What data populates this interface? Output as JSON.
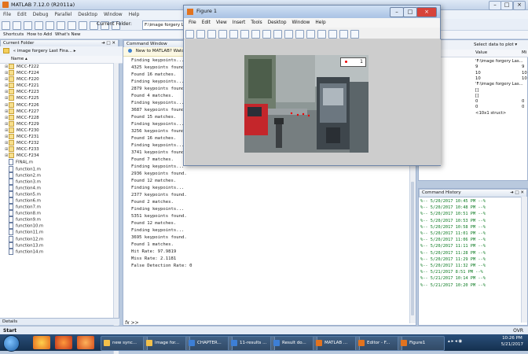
{
  "app": {
    "title": "MATLAB 7.12.0 (R2011a)",
    "menu": [
      "File",
      "Edit",
      "Debug",
      "Parallel",
      "Desktop",
      "Window",
      "Help"
    ],
    "current_folder_label": "Current Folder:",
    "current_folder_value": "F:\\image forgery Last Final\\...",
    "shortcuts": [
      "Shortcuts",
      "How to Add",
      "What's New"
    ]
  },
  "current_folder": {
    "header": "Current Folder",
    "path": "« image forgery Last Fina... ▸",
    "col_name": "Name ▴",
    "folders": [
      "MICC-F222",
      "MICC-F224",
      "MICC-F220",
      "MICC-F221",
      "MICC-F223",
      "MICC-F225",
      "MICC-F226",
      "MICC-F227",
      "MICC-F228",
      "MICC-F229",
      "MICC-F230",
      "MICC-F231",
      "MICC-F232",
      "MICC-F233",
      "MICC-F234"
    ],
    "files": [
      "FINAL.m",
      "function1.m",
      "function2.m",
      "function3.m",
      "function4.m",
      "function5.m",
      "function6.m",
      "function7.m",
      "function8.m",
      "function9.m",
      "function10.m",
      "function11.m",
      "function12.m",
      "function13.m",
      "function14.m"
    ],
    "details": "Details"
  },
  "command_window": {
    "header": "Command Window",
    "notice": "New to MATLAB? Watch this Video, see Demos, or read Getting Started.",
    "lines": [
      "Finding keypoints...",
      "4325 keypoints found.",
      "Found 16 matches.",
      "Finding keypoints...",
      "2879 keypoints found.",
      "Found 4 matches.",
      "Finding keypoints...",
      "3687 keypoints found.",
      "Found 15 matches.",
      "Finding keypoints...",
      "3256 keypoints found.",
      "Found 16 matches.",
      "Finding keypoints...",
      "3741 keypoints found.",
      "Found 7 matches.",
      "Finding keypoints...",
      "2936 keypoints found.",
      "Found 12 matches.",
      "Finding keypoints...",
      "2377 keypoints found.",
      "Found 2 matches.",
      "Finding keypoints...",
      "5351 keypoints found.",
      "Found 12 matches.",
      "Finding keypoints...",
      "3695 keypoints found.",
      "Found 1 matches.",
      "Hit Rate: 97.9819",
      "Miss Rate: 2.1181",
      "False Detection Rate: 0"
    ],
    "prompt": "fx >>"
  },
  "workspace": {
    "select_plot": "Select data to plot ▾",
    "col_value": "Value",
    "col_min": "Mi",
    "rows": [
      {
        "value": "'F:\\image forgery Las...",
        "min": ""
      },
      {
        "value": "9",
        "min": "9"
      },
      {
        "value": "10",
        "min": "10"
      },
      {
        "value": "10",
        "min": "10"
      },
      {
        "value": "'F:\\image forgery Las...",
        "min": ""
      },
      {
        "value": "[]",
        "min": ""
      },
      {
        "value": "[]",
        "min": ""
      },
      {
        "value": "0",
        "min": "0"
      },
      {
        "value": "0",
        "min": "0"
      },
      {
        "value": "<10x1 struct>",
        "min": ""
      }
    ]
  },
  "command_history": {
    "header": "Command History",
    "entries": [
      "%-- 5/20/2017 10:45 PM --%",
      "%-- 5/20/2017 10:48 PM --%",
      "%-- 5/20/2017 10:51 PM --%",
      "%-- 5/20/2017 10:53 PM --%",
      "%-- 5/20/2017 10:58 PM --%",
      "%-- 5/20/2017 11:01 PM --%",
      "%-- 5/20/2017 11:06 PM --%",
      "%-- 5/20/2017 11:11 PM --%",
      "%-- 5/20/2017 11:28 PM --%",
      "%-- 5/20/2017 11:29 PM --%",
      "%-- 5/20/2017 11:32 PM --%",
      "%-- 5/21/2017 8:51 PM --%",
      "%-- 5/21/2017 10:14 PM --%",
      "%-- 5/21/2017 10:20 PM --%"
    ]
  },
  "status": {
    "start": "Start",
    "ovr": "OVR"
  },
  "figure": {
    "title": "Figure 1",
    "menu": [
      "File",
      "Edit",
      "View",
      "Insert",
      "Tools",
      "Desktop",
      "Window",
      "Help"
    ],
    "legend_label": "1"
  },
  "taskbar": {
    "items": [
      "new sync...",
      "image for...",
      "CHAPTER...",
      "11-results ...",
      "Result do...",
      "MATLAB ...",
      "Editor - F...",
      "Figure1"
    ],
    "clock_time": "10:26 PM",
    "clock_date": "5/21/2017"
  }
}
